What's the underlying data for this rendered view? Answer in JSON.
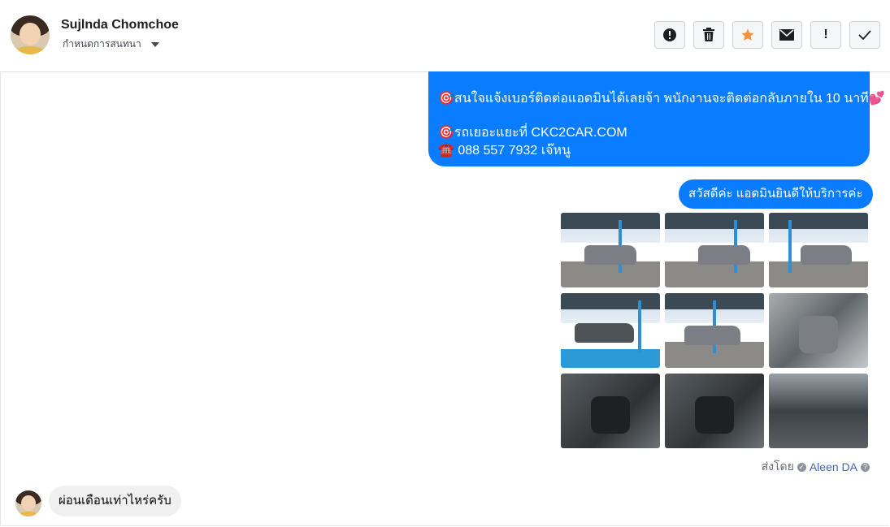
{
  "header": {
    "contact_name": "Sujlnda Chomchoe",
    "subtitle": "กำหนดการสนทนา",
    "actions": [
      {
        "name": "spam-button",
        "icon": "alert-circle-icon",
        "glyph": "!"
      },
      {
        "name": "delete-button",
        "icon": "trash-icon",
        "glyph": "🗑"
      },
      {
        "name": "star-button",
        "icon": "star-icon",
        "glyph": "★"
      },
      {
        "name": "mail-button",
        "icon": "envelope-icon",
        "glyph": "✉"
      },
      {
        "name": "priority-button",
        "icon": "exclamation-icon",
        "glyph": "!"
      },
      {
        "name": "done-button",
        "icon": "check-icon",
        "glyph": "✓"
      }
    ]
  },
  "messages": {
    "outgoing_main": {
      "line1": "🎯สนใจแจ้งเบอร์ติดต่อแอดมินได้เลยจ้า พนักงานจะติดต่อกลับภายใน 10 นาที💕",
      "line2": "🎯รถเยอะแยะที่ CKC2CAR.COM",
      "line3": "☎️ 088 557 7932 เจ๊หนู"
    },
    "greeting": "สวัสดีค่ะ แอดมินยินดีให้บริการค่ะ",
    "sent_by_label": "ส่งโดย",
    "sent_by_name": "Aleen DA",
    "incoming": "ผ่อนเดือนเท่าไหร่ครับ"
  },
  "colors": {
    "bubble_blue": "#0a7cff",
    "star_orange": "#f7923b",
    "incoming_bg": "#f0f0f0"
  },
  "photos": [
    {
      "kind": "parking-lot-car"
    },
    {
      "kind": "parking-lot-car"
    },
    {
      "kind": "parking-lot-car"
    },
    {
      "kind": "parking-lot-car"
    },
    {
      "kind": "parking-lot-car"
    },
    {
      "kind": "interior-seats"
    },
    {
      "kind": "interior-dashboard"
    },
    {
      "kind": "interior-dashboard"
    },
    {
      "kind": "engine-bay"
    }
  ]
}
